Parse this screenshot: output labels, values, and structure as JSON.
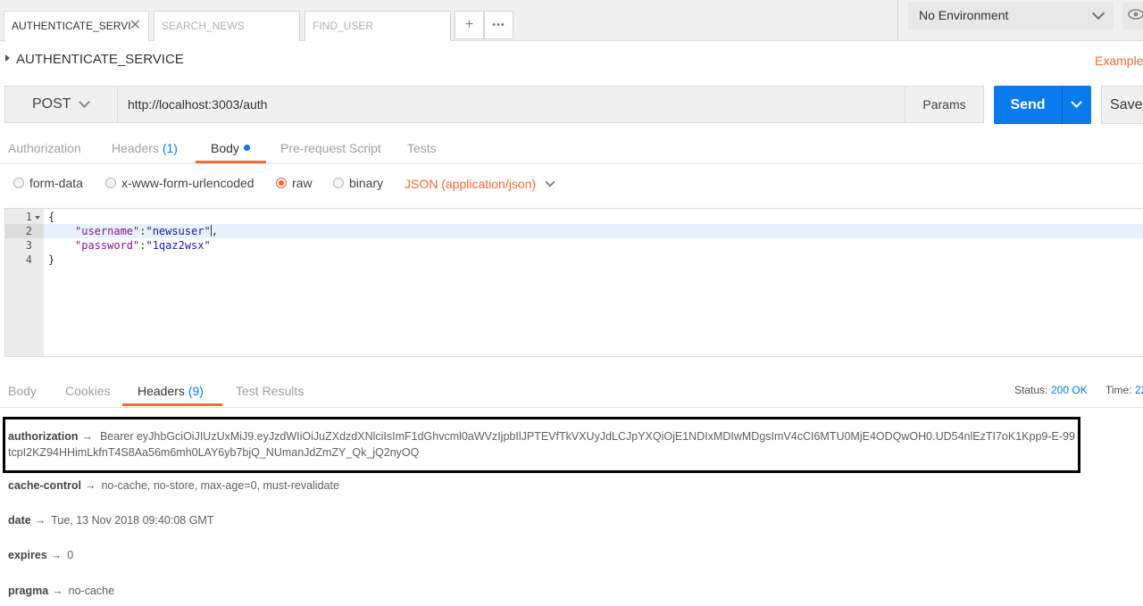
{
  "tabs": [
    {
      "label": "AUTHENTICATE_SERVI",
      "active": true
    },
    {
      "label": "SEARCH_NEWS",
      "active": false
    },
    {
      "label": "FIND_USER",
      "active": false
    }
  ],
  "tab_actions": {
    "add": "+",
    "more": "•••"
  },
  "environment": {
    "selected": "No Environment"
  },
  "request": {
    "name": "AUTHENTICATE_SERVICE",
    "examples_label": "Examples",
    "method": "POST",
    "url": "http://localhost:3003/auth",
    "params_label": "Params",
    "send_label": "Send",
    "save_label": "Save"
  },
  "request_tabs": [
    {
      "label": "Authorization"
    },
    {
      "label": "Headers",
      "count": "(1)"
    },
    {
      "label": "Body",
      "active": true
    },
    {
      "label": "Pre-request Script"
    },
    {
      "label": "Tests"
    }
  ],
  "body_types": [
    {
      "label": "form-data",
      "selected": false
    },
    {
      "label": "x-www-form-urlencoded",
      "selected": false
    },
    {
      "label": "raw",
      "selected": true
    },
    {
      "label": "binary",
      "selected": false
    }
  ],
  "raw_format": "JSON (application/json)",
  "editor": {
    "line_numbers": [
      "1",
      "2",
      "3",
      "4"
    ],
    "lines": [
      {
        "text": "{"
      },
      {
        "key": "\"username\"",
        "sep": ":",
        "value": "\"newsuser\"",
        "tail": ","
      },
      {
        "key": "\"password\"",
        "sep": ":",
        "value": "\"1qaz2wsx\"",
        "tail": ""
      },
      {
        "text": "}"
      }
    ]
  },
  "response_tabs": [
    {
      "label": "Body"
    },
    {
      "label": "Cookies"
    },
    {
      "label": "Headers",
      "count": "(9)",
      "active": true
    },
    {
      "label": "Test Results"
    }
  ],
  "response_status": {
    "status_label": "Status:",
    "status_value": "200 OK",
    "time_label": "Time:",
    "time_value": "22"
  },
  "response_headers": [
    {
      "key": "authorization",
      "arrow": "→",
      "value": "Bearer eyJhbGciOiJIUzUxMiJ9.eyJzdWIiOiJuZXdzdXNlciIsImF1dGhvcml0aWVzIjpbIlJPTEVfTkVXUyJdLCJpYXQiOjE1NDIxMDIwMDgsImV4cCI6MTU0MjE4ODQwOH0.UD54nlEzTI7oK1Kpp9-E-99tcpI2KZ94HHimLkfnT4S8Aa56m6mh0LAY6yb7bjQ_NUmanJdZmZY_Qk_jQ2nyOQ"
    },
    {
      "key": "cache-control",
      "arrow": "→",
      "value": "no-cache, no-store, max-age=0, must-revalidate"
    },
    {
      "key": "date",
      "arrow": "→",
      "value": "Tue, 13 Nov 2018 09:40:08 GMT"
    },
    {
      "key": "expires",
      "arrow": "→",
      "value": "0"
    },
    {
      "key": "pragma",
      "arrow": "→",
      "value": "no-cache"
    }
  ]
}
